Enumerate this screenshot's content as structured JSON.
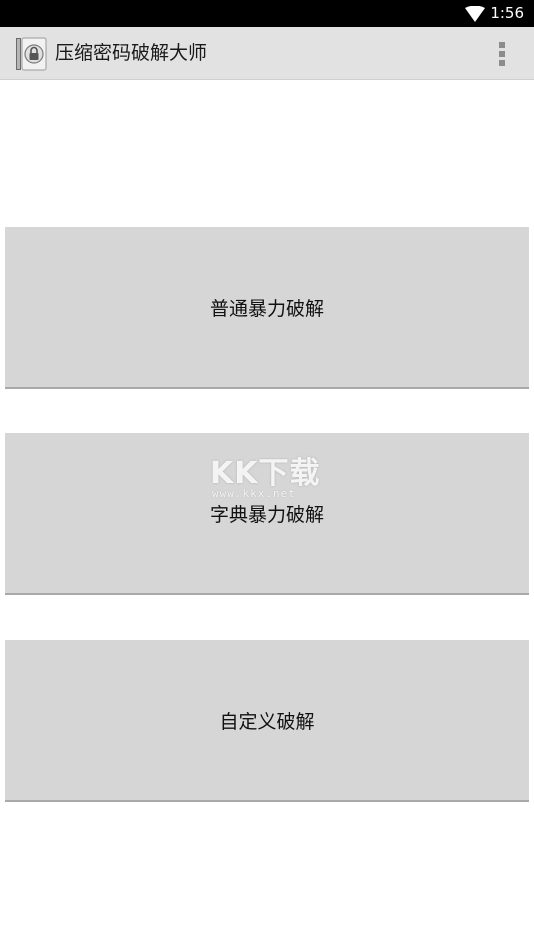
{
  "status_bar": {
    "time": "1:56",
    "wifi_icon": "wifi-icon"
  },
  "action_bar": {
    "app_icon": "lock-archive-icon",
    "title": "压缩密码破解大师",
    "overflow_icon": "overflow-menu-icon"
  },
  "buttons": [
    {
      "label": "普通暴力破解"
    },
    {
      "label": "字典暴力破解"
    },
    {
      "label": "自定义破解"
    }
  ],
  "watermark": {
    "logo": "KK下载",
    "url": "www.kkx.net"
  },
  "colors": {
    "status_bar_bg": "#000000",
    "action_bar_bg": "#e2e2e2",
    "button_bg": "#d6d6d6",
    "page_bg": "#ffffff"
  }
}
